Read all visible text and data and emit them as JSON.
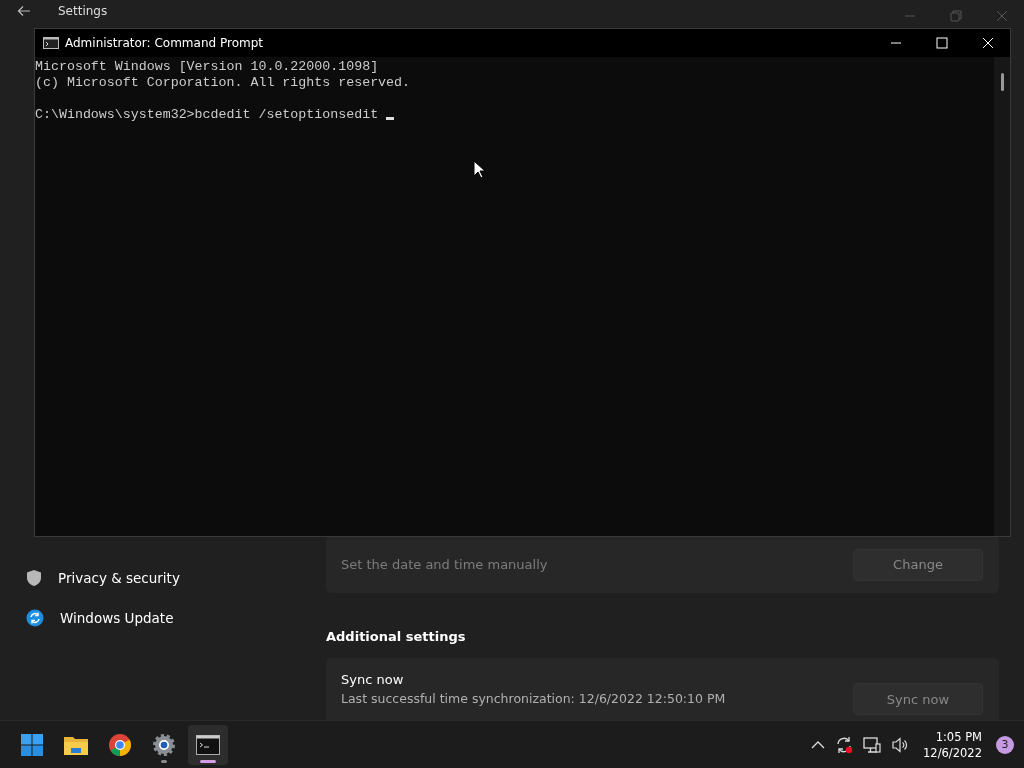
{
  "settings_window": {
    "title": "Settings",
    "sidebar": {
      "items": [
        {
          "label": "Privacy & security",
          "kind": "shield"
        },
        {
          "label": "Windows Update",
          "kind": "update"
        }
      ]
    },
    "date_time_card": {
      "label": "Set the date and time manually",
      "button": "Change"
    },
    "additional_settings": {
      "heading": "Additional settings",
      "sync_card": {
        "title": "Sync now",
        "detail": "Last successful time synchronization: 12/6/2022 12:50:10 PM",
        "button": "Sync now"
      }
    }
  },
  "command_prompt": {
    "title": "Administrator: Command Prompt",
    "lines": [
      "Microsoft Windows [Version 10.0.22000.1098]",
      "(c) Microsoft Corporation. All rights reserved."
    ],
    "prompt": "C:\\Windows\\system32>bcdedit /setoptionsedit "
  },
  "taskbar": {
    "apps": [
      {
        "kind": "start",
        "running": false,
        "selected": false
      },
      {
        "kind": "explorer",
        "running": false,
        "selected": false
      },
      {
        "kind": "chrome",
        "running": false,
        "selected": false
      },
      {
        "kind": "settings",
        "running": true,
        "selected": false
      },
      {
        "kind": "terminal",
        "running": true,
        "selected": true
      }
    ],
    "tray": {
      "time": "1:05 PM",
      "date": "12/6/2022",
      "notification_count": "3"
    }
  }
}
